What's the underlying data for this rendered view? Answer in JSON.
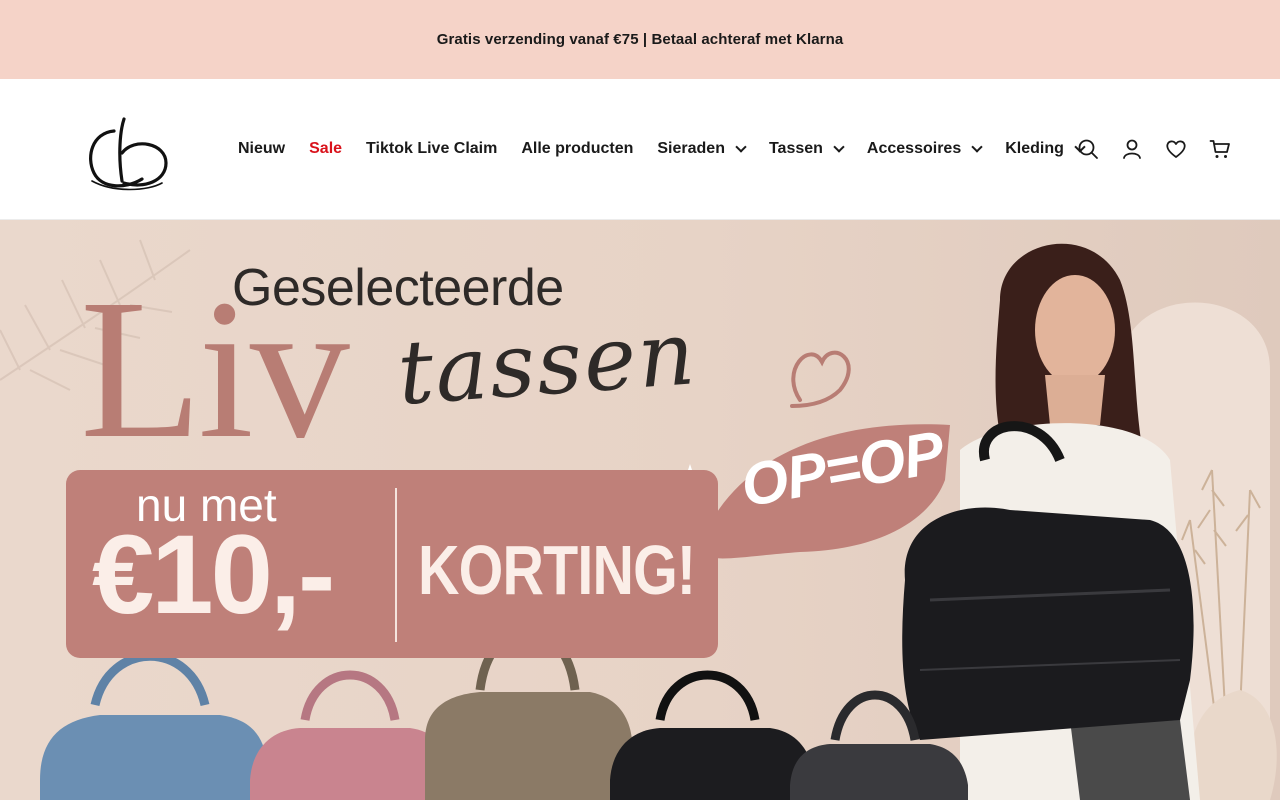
{
  "announcement": {
    "text": "Gratis verzending vanaf €75 | Betaal achteraf met Klarna"
  },
  "header": {
    "logo_alt": "cb",
    "nav": [
      {
        "label": "Nieuw",
        "dropdown": false
      },
      {
        "label": "Sale",
        "dropdown": false,
        "highlight": "#d9121b"
      },
      {
        "label": "Tiktok Live Claim",
        "dropdown": false
      },
      {
        "label": "Alle producten",
        "dropdown": false
      },
      {
        "label": "Sieraden",
        "dropdown": true
      },
      {
        "label": "Tassen",
        "dropdown": true
      },
      {
        "label": "Accessoires",
        "dropdown": true
      },
      {
        "label": "Kleding",
        "dropdown": true
      }
    ],
    "icons": [
      "search-icon",
      "account-icon",
      "wishlist-icon",
      "cart-icon"
    ]
  },
  "hero": {
    "headline_top": "Geselecteerde",
    "brand": "Liv",
    "script_word": "tassen",
    "promo_prefix": "nu met",
    "promo_amount": "€10,-",
    "promo_suffix": "KORTING!",
    "stamp": "OP=OP",
    "colors": {
      "background": "#e7d3c6",
      "accent_rose": "#bf8079",
      "brand_rose": "#b87d74",
      "dark_text": "#2e2a28"
    },
    "bag_colors": [
      "#6b8fb3",
      "#c9848f",
      "#8b7a66",
      "#1c1c1f",
      "#3a3a3e"
    ]
  }
}
